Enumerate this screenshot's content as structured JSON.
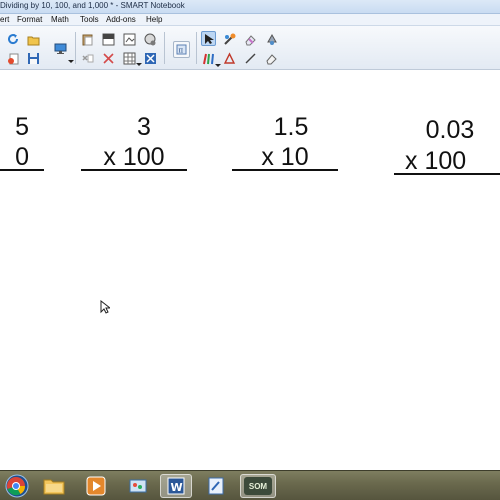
{
  "window": {
    "title": "Dividing by 10, 100, and 1,000 * - SMART Notebook"
  },
  "menu": [
    "ert",
    "Format",
    "Math",
    "Tools",
    "Add-ons",
    "Help"
  ],
  "toolbar": {
    "icons": [
      "redo-icon",
      "open-icon",
      "delete-page-icon",
      "save-icon",
      "display-icon",
      "paste-icon",
      "screen-shade-icon",
      "capture-icon",
      "table-icon",
      "clear-icon",
      "undo-icon",
      "math-icon",
      "select-icon",
      "magic-pen-icon",
      "eraser-tool-icon",
      "fill-icon",
      "pens-icon",
      "shapes-icon",
      "line-icon",
      "eraser-icon"
    ]
  },
  "canvas": {
    "problems": [
      {
        "top": "5",
        "bottom": "0"
      },
      {
        "top": "3",
        "bottom": "x 100"
      },
      {
        "top": "1.5",
        "bottom": "x 10"
      },
      {
        "top": "0.03",
        "bottom": "x 100"
      }
    ]
  },
  "taskbar": {
    "apps": [
      "start-orb",
      "chrome",
      "explorer",
      "media-player",
      "paint",
      "word",
      "notebook",
      "smart-app"
    ],
    "smart_label": "SOM"
  }
}
